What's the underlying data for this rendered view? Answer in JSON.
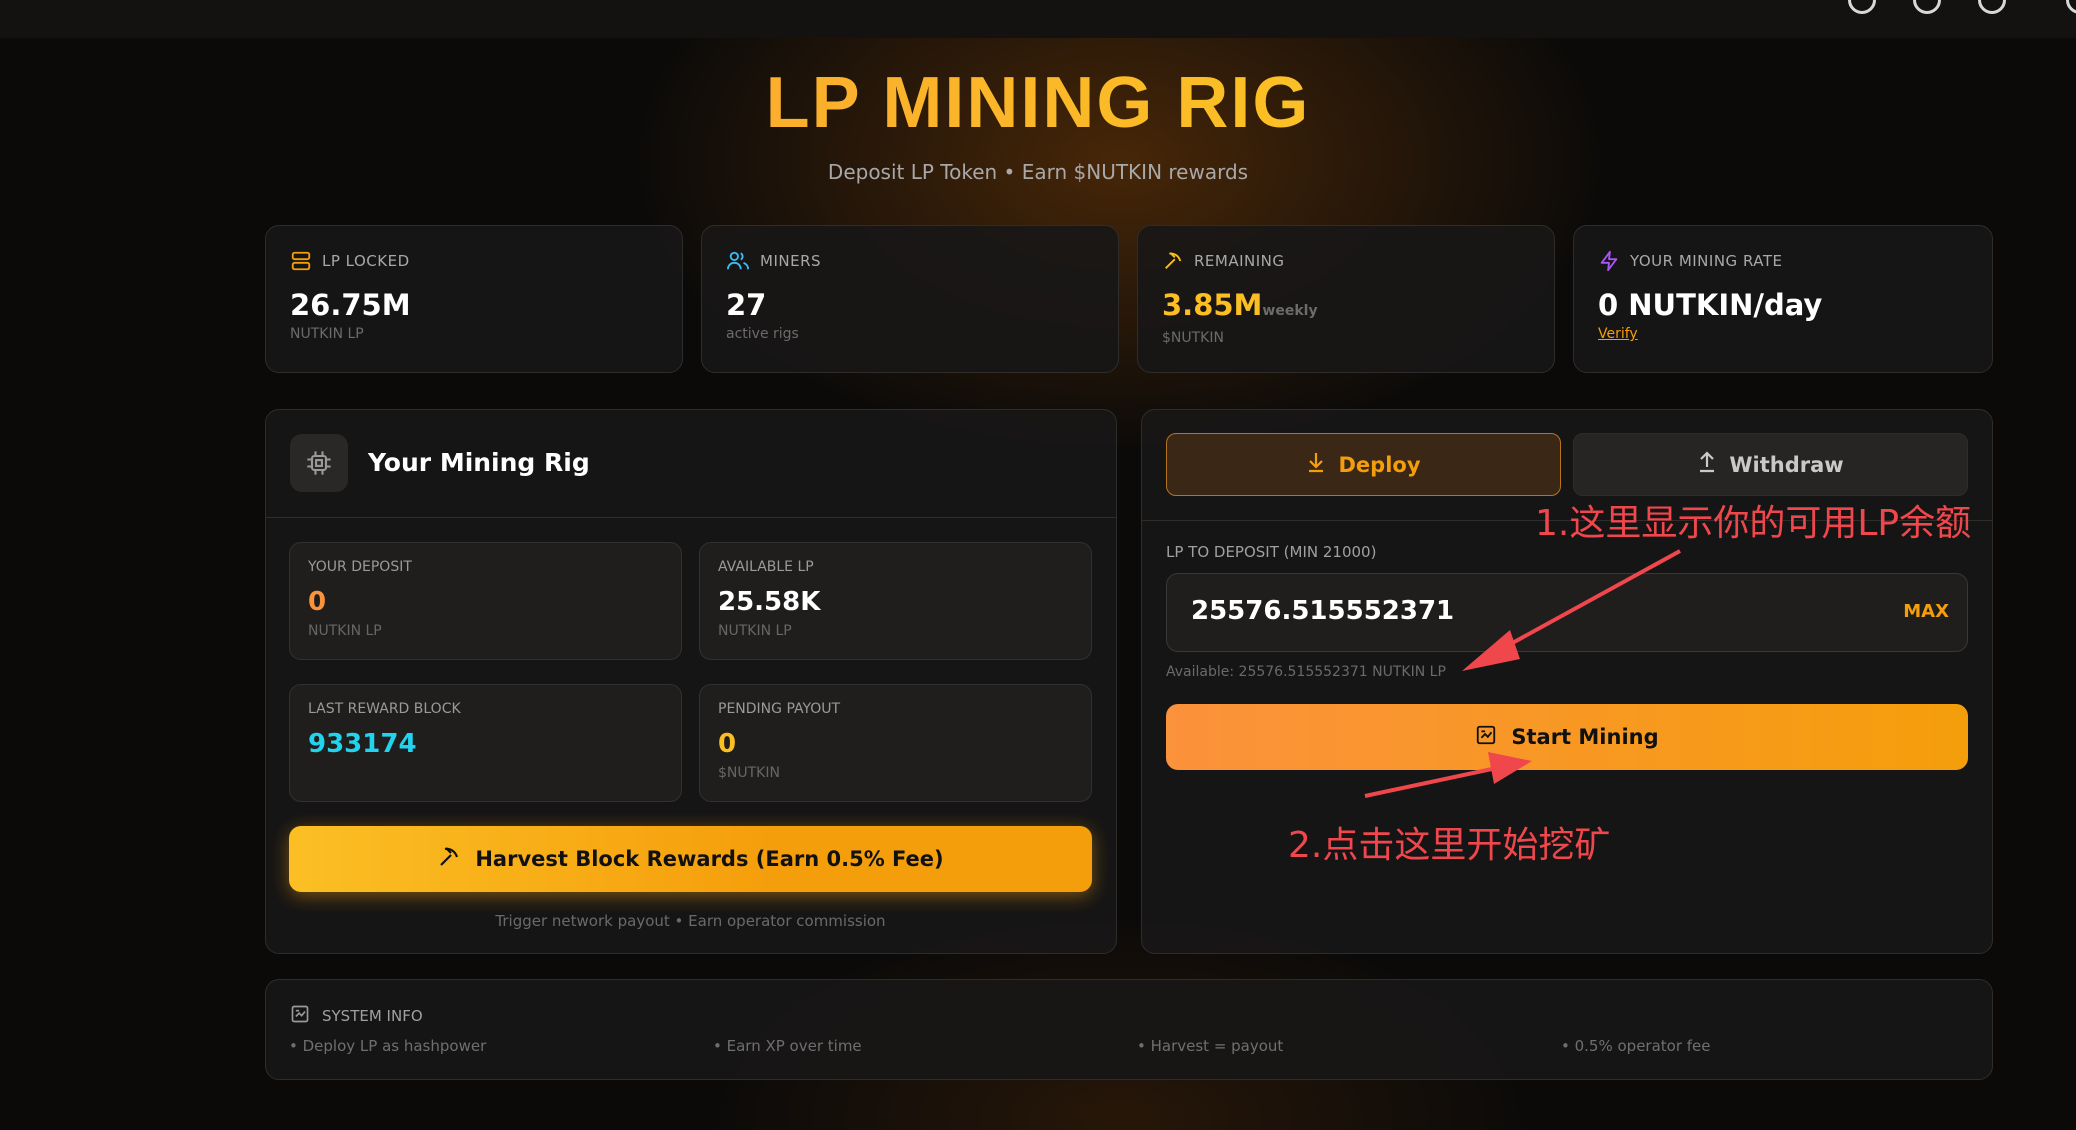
{
  "header": {
    "title": "LP MINING RIG",
    "subtitle": "Deposit LP Token • Earn $NUTKIN rewards"
  },
  "stats": [
    {
      "label": "LP LOCKED",
      "value": "26.75M",
      "sub": "NUTKIN LP",
      "icon": "server-icon",
      "color": "#f59e0b"
    },
    {
      "label": "MINERS",
      "value": "27",
      "sub": "active rigs",
      "icon": "users-icon",
      "color": "#38bdf8"
    },
    {
      "label": "REMAINING",
      "value": "3.85M",
      "value_suffix": "weekly",
      "sub": "$NUTKIN",
      "icon": "pickaxe-icon",
      "color": "#fbbf24"
    },
    {
      "label": "YOUR MINING RATE",
      "value": "0 NUTKIN/day",
      "link": "Verify",
      "icon": "zap-icon",
      "color": "#a855f7"
    }
  ],
  "rig": {
    "title": "Your Mining Rig",
    "your_deposit": {
      "label": "YOUR DEPOSIT",
      "value": "0",
      "sub": "NUTKIN LP"
    },
    "available_lp": {
      "label": "AVAILABLE LP",
      "value": "25.58K",
      "sub": "NUTKIN LP"
    },
    "last_reward_block": {
      "label": "LAST REWARD BLOCK",
      "value": "933174"
    },
    "pending_payout": {
      "label": "PENDING PAYOUT",
      "value": "0",
      "sub": "$NUTKIN"
    },
    "harvest_button": "Harvest Block Rewards (Earn 0.5% Fee)",
    "harvest_note": "Trigger network payout • Earn operator commission"
  },
  "deposit": {
    "tabs": {
      "deploy": "Deploy",
      "withdraw": "Withdraw"
    },
    "field_label": "LP TO DEPOSIT (MIN 21000)",
    "amount": "25576.515552371",
    "max_label": "MAX",
    "available_text": "Available: 25576.515552371 NUTKIN LP",
    "start_button": "Start Mining"
  },
  "annotations": {
    "note1": "1.这里显示你的可用LP余额",
    "note2": "2.点击这里开始挖矿",
    "color": "#f0474c"
  },
  "system_info": {
    "label": "SYSTEM INFO",
    "items": [
      "• Deploy LP as hashpower",
      "• Earn XP over time",
      "• Harvest = payout",
      "• 0.5% operator fee"
    ]
  },
  "colors": {
    "accent": "#f59e0b",
    "block": "#22d3ee",
    "deposit_value": "#fb923c",
    "pending_value": "#fbbf24"
  }
}
